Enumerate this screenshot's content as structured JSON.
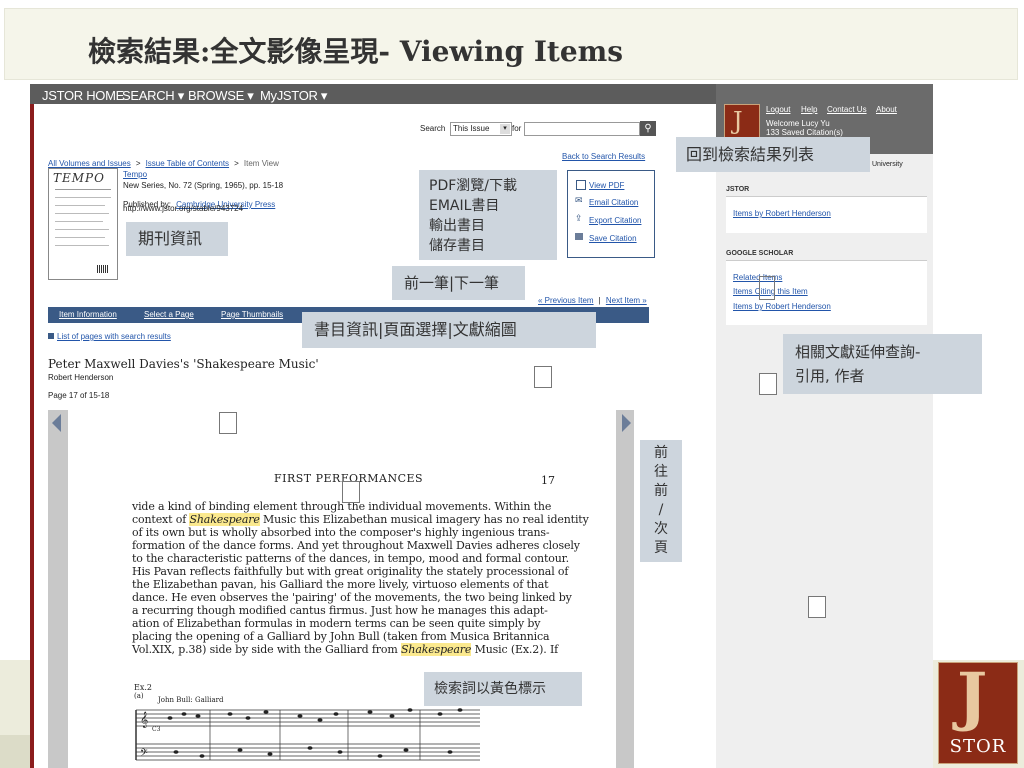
{
  "slide": {
    "title": "檢索結果:全文影像呈現- Viewing Items"
  },
  "nav": {
    "home": "JSTOR HOME",
    "search": "SEARCH",
    "browse": "BROWSE",
    "myjstor": "MyJSTOR"
  },
  "search_bar": {
    "label": "Search",
    "scope": "This Issue",
    "for_label": "for",
    "value": ""
  },
  "breadcrumb": {
    "all": "All Volumes and Issues",
    "sep1": ">",
    "toc": "Issue Table of Contents",
    "sep2": ">",
    "current": "Item View"
  },
  "back_link": "Back to Search Results",
  "journal": {
    "cover_title": "TEMPO",
    "name": "Tempo",
    "series": "New Series, No. 72 (Spring, 1965), pp. 15-18",
    "published_by_label": "Published by:",
    "publisher": "Cambridge University Press",
    "url": "http://www.jstor.org/stable/943724"
  },
  "actions": {
    "view_pdf": "View PDF",
    "email": "Email Citation",
    "export": "Export Citation",
    "save": "Save Citation"
  },
  "pager": {
    "prev": "« Previous Item",
    "sep": "|",
    "next": "Next Item »"
  },
  "tabs": {
    "info": "Item Information",
    "select": "Select a Page",
    "thumbs": "Page Thumbnails"
  },
  "list_pages": "List of pages with search results",
  "article": {
    "title": "Peter Maxwell Davies's 'Shakespeare Music'",
    "author": "Robert Henderson",
    "page_info": "Page 17 of 15-18"
  },
  "sidebar": {
    "logout": "Logout",
    "help": "Help",
    "contact": "Contact Us",
    "about": "About",
    "welcome": "Welcome Lucy Yu",
    "saved": "133 Saved Citation(s)",
    "university": "University",
    "jstor_head": "JSTOR",
    "jstor_link": "Items by Robert Henderson",
    "gs_head": "GOOGLE SCHOLAR",
    "gs_related": "Related Items",
    "gs_citing": "Items Citing this Item",
    "gs_author": "Items by Robert Henderson"
  },
  "callouts": {
    "back": "回到檢索結果列表",
    "actions": [
      "PDF瀏覽/下載",
      "EMAIL書目",
      "輸出書目",
      "儲存書目"
    ],
    "journal": "期刊資訊",
    "prev_next": "前一筆|下一筆",
    "tabs": "書目資訊|頁面選擇|文獻縮圖",
    "related": [
      "相關文獻延伸查詢-",
      "引用, 作者"
    ],
    "page_nav": [
      "前",
      "往",
      "前",
      "/",
      "次",
      "頁"
    ],
    "highlight": "檢索詞以黃色標示"
  },
  "document": {
    "header": "FIRST PERFORMANCES",
    "page_no": "17",
    "lines": [
      [
        "vide a kind of binding element through the individual movements.  Within the",
        "",
        ""
      ],
      [
        "context of ",
        "Shakespeare",
        " Music this Elizabethan musical imagery has no real identity"
      ],
      [
        "of its own but is wholly absorbed into the composer's highly ingenious trans-",
        "",
        ""
      ],
      [
        "formation of the dance forms.  And yet throughout Maxwell Davies adheres closely",
        "",
        ""
      ],
      [
        "to the characteristic patterns of the dances, in tempo, mood and formal contour.",
        "",
        ""
      ],
      [
        "His Pavan reflects faithfully but with great originality the stately processional of",
        "",
        ""
      ],
      [
        "the Elizabethan pavan, his Galliard the more lively, virtuoso elements of that",
        "",
        ""
      ],
      [
        "dance.  He even observes the 'pairing' of the movements, the two being linked by",
        "",
        ""
      ],
      [
        "a recurring though modified cantus firmus.  Just how he manages this adapt-",
        "",
        ""
      ],
      [
        "ation of Elizabethan formulas in modern terms can be seen quite simply by",
        "",
        ""
      ],
      [
        "placing the opening of a Galliard by John Bull (taken from Musica Britannica",
        "",
        ""
      ],
      [
        "Vol.XIX, p.38) side by side with the Galliard from ",
        "Shakespeare",
        " Music (Ex.2).  If"
      ]
    ],
    "example_label": "Ex.2",
    "example_sub": "(a)",
    "example_caption": "John Bull: Galliard",
    "example_mark": "C3"
  },
  "logo": {
    "text": "STOR"
  },
  "colors": {
    "nav": "#5c5c5c",
    "tabs": "#3a5a86",
    "highlight": "#fbe98e",
    "callout": "#cdd5dd",
    "brand": "#8b2b16"
  }
}
